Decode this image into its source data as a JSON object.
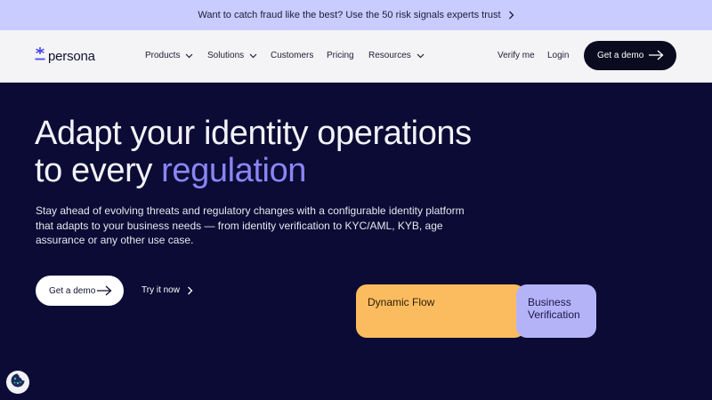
{
  "banner": {
    "text": "Want to catch fraud like the best? Use the 50 risk signals experts trust"
  },
  "nav": {
    "logo": "persona",
    "items": [
      {
        "label": "Products"
      },
      {
        "label": "Solutions"
      },
      {
        "label": "Customers"
      },
      {
        "label": "Pricing"
      },
      {
        "label": "Resources"
      }
    ],
    "verify": "Verify me",
    "login": "Login",
    "cta": "Get a demo"
  },
  "hero": {
    "title_line1": "Adapt your identity operations",
    "title_line2_prefix": "to every ",
    "title_line2_accent": "regulation",
    "lead": "Stay ahead of evolving threats and regulatory changes with a configurable identity platform that adapts to your business needs — from identity verification to KYC/AML, KYB, age assurance or any other use case.",
    "cta_primary": "Get a demo",
    "cta_secondary": "Try it now"
  },
  "cards": [
    {
      "label": "Dynamic Flow"
    },
    {
      "label": "Business Verification"
    }
  ],
  "colors": {
    "banner_bg": "#c9ccff",
    "nav_bg": "#f4f4f6",
    "hero_bg": "#0b0b35",
    "accent": "#8a86f4",
    "card_orange": "#fbbc5f",
    "card_purple": "#b5b3f8"
  },
  "icons": [
    "chevron-right-icon",
    "chevron-down-icon",
    "arrow-right-icon",
    "asterisk-logo-icon",
    "cookie-icon"
  ]
}
